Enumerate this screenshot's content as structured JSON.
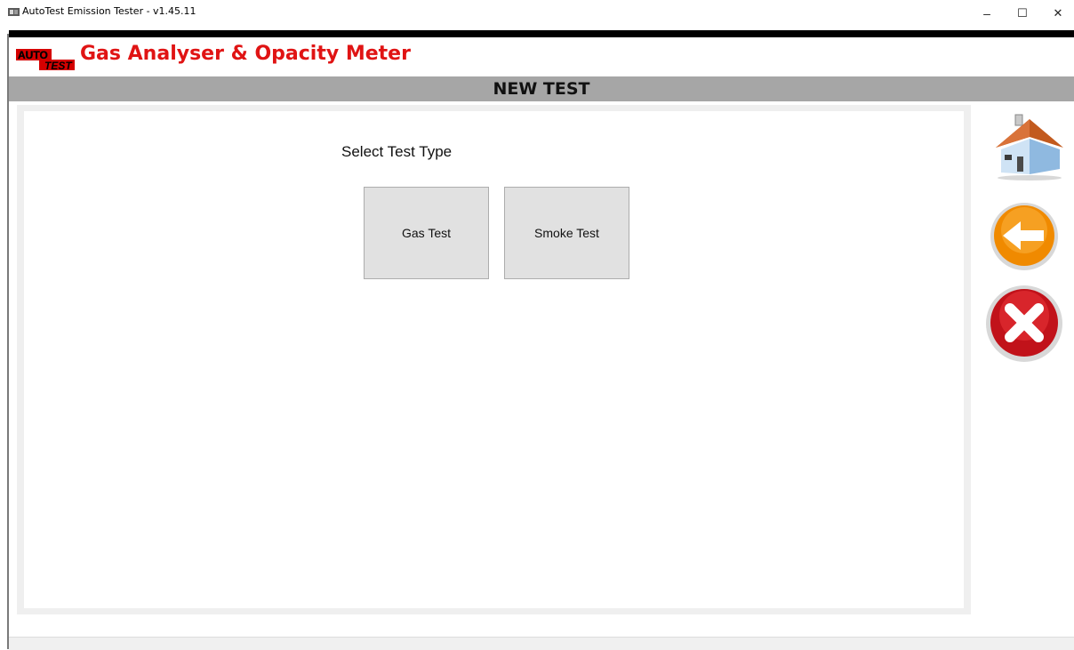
{
  "window": {
    "title": "AutoTest Emission Tester - v1.45.11",
    "minimize_glyph": "–",
    "maximize_glyph": "☐",
    "close_glyph": "✕"
  },
  "header": {
    "logo_line1": "AUTO",
    "logo_line2": "TEST",
    "title": "Gas Analyser & Opacity Meter",
    "title_color": "#e01414"
  },
  "page": {
    "section_title": "NEW TEST",
    "prompt": "Select Test Type",
    "buttons": [
      {
        "label": "Gas Test"
      },
      {
        "label": "Smoke Test"
      }
    ]
  },
  "side_nav": [
    {
      "icon": "home-icon"
    },
    {
      "icon": "back-arrow-icon"
    },
    {
      "icon": "close-x-icon"
    }
  ]
}
